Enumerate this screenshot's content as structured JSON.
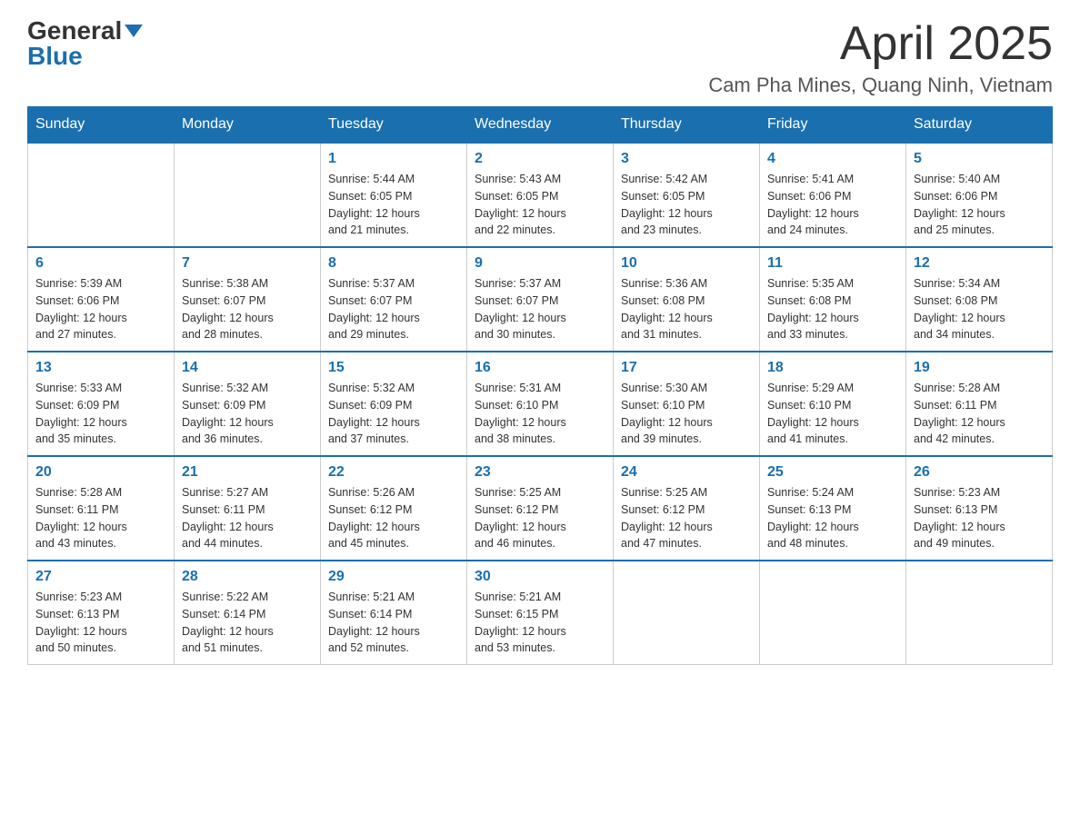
{
  "header": {
    "logo_general": "General",
    "logo_blue": "Blue",
    "month_title": "April 2025",
    "location": "Cam Pha Mines, Quang Ninh, Vietnam"
  },
  "days_of_week": [
    "Sunday",
    "Monday",
    "Tuesday",
    "Wednesday",
    "Thursday",
    "Friday",
    "Saturday"
  ],
  "weeks": [
    [
      {
        "day": "",
        "info": ""
      },
      {
        "day": "",
        "info": ""
      },
      {
        "day": "1",
        "info": "Sunrise: 5:44 AM\nSunset: 6:05 PM\nDaylight: 12 hours\nand 21 minutes."
      },
      {
        "day": "2",
        "info": "Sunrise: 5:43 AM\nSunset: 6:05 PM\nDaylight: 12 hours\nand 22 minutes."
      },
      {
        "day": "3",
        "info": "Sunrise: 5:42 AM\nSunset: 6:05 PM\nDaylight: 12 hours\nand 23 minutes."
      },
      {
        "day": "4",
        "info": "Sunrise: 5:41 AM\nSunset: 6:06 PM\nDaylight: 12 hours\nand 24 minutes."
      },
      {
        "day": "5",
        "info": "Sunrise: 5:40 AM\nSunset: 6:06 PM\nDaylight: 12 hours\nand 25 minutes."
      }
    ],
    [
      {
        "day": "6",
        "info": "Sunrise: 5:39 AM\nSunset: 6:06 PM\nDaylight: 12 hours\nand 27 minutes."
      },
      {
        "day": "7",
        "info": "Sunrise: 5:38 AM\nSunset: 6:07 PM\nDaylight: 12 hours\nand 28 minutes."
      },
      {
        "day": "8",
        "info": "Sunrise: 5:37 AM\nSunset: 6:07 PM\nDaylight: 12 hours\nand 29 minutes."
      },
      {
        "day": "9",
        "info": "Sunrise: 5:37 AM\nSunset: 6:07 PM\nDaylight: 12 hours\nand 30 minutes."
      },
      {
        "day": "10",
        "info": "Sunrise: 5:36 AM\nSunset: 6:08 PM\nDaylight: 12 hours\nand 31 minutes."
      },
      {
        "day": "11",
        "info": "Sunrise: 5:35 AM\nSunset: 6:08 PM\nDaylight: 12 hours\nand 33 minutes."
      },
      {
        "day": "12",
        "info": "Sunrise: 5:34 AM\nSunset: 6:08 PM\nDaylight: 12 hours\nand 34 minutes."
      }
    ],
    [
      {
        "day": "13",
        "info": "Sunrise: 5:33 AM\nSunset: 6:09 PM\nDaylight: 12 hours\nand 35 minutes."
      },
      {
        "day": "14",
        "info": "Sunrise: 5:32 AM\nSunset: 6:09 PM\nDaylight: 12 hours\nand 36 minutes."
      },
      {
        "day": "15",
        "info": "Sunrise: 5:32 AM\nSunset: 6:09 PM\nDaylight: 12 hours\nand 37 minutes."
      },
      {
        "day": "16",
        "info": "Sunrise: 5:31 AM\nSunset: 6:10 PM\nDaylight: 12 hours\nand 38 minutes."
      },
      {
        "day": "17",
        "info": "Sunrise: 5:30 AM\nSunset: 6:10 PM\nDaylight: 12 hours\nand 39 minutes."
      },
      {
        "day": "18",
        "info": "Sunrise: 5:29 AM\nSunset: 6:10 PM\nDaylight: 12 hours\nand 41 minutes."
      },
      {
        "day": "19",
        "info": "Sunrise: 5:28 AM\nSunset: 6:11 PM\nDaylight: 12 hours\nand 42 minutes."
      }
    ],
    [
      {
        "day": "20",
        "info": "Sunrise: 5:28 AM\nSunset: 6:11 PM\nDaylight: 12 hours\nand 43 minutes."
      },
      {
        "day": "21",
        "info": "Sunrise: 5:27 AM\nSunset: 6:11 PM\nDaylight: 12 hours\nand 44 minutes."
      },
      {
        "day": "22",
        "info": "Sunrise: 5:26 AM\nSunset: 6:12 PM\nDaylight: 12 hours\nand 45 minutes."
      },
      {
        "day": "23",
        "info": "Sunrise: 5:25 AM\nSunset: 6:12 PM\nDaylight: 12 hours\nand 46 minutes."
      },
      {
        "day": "24",
        "info": "Sunrise: 5:25 AM\nSunset: 6:12 PM\nDaylight: 12 hours\nand 47 minutes."
      },
      {
        "day": "25",
        "info": "Sunrise: 5:24 AM\nSunset: 6:13 PM\nDaylight: 12 hours\nand 48 minutes."
      },
      {
        "day": "26",
        "info": "Sunrise: 5:23 AM\nSunset: 6:13 PM\nDaylight: 12 hours\nand 49 minutes."
      }
    ],
    [
      {
        "day": "27",
        "info": "Sunrise: 5:23 AM\nSunset: 6:13 PM\nDaylight: 12 hours\nand 50 minutes."
      },
      {
        "day": "28",
        "info": "Sunrise: 5:22 AM\nSunset: 6:14 PM\nDaylight: 12 hours\nand 51 minutes."
      },
      {
        "day": "29",
        "info": "Sunrise: 5:21 AM\nSunset: 6:14 PM\nDaylight: 12 hours\nand 52 minutes."
      },
      {
        "day": "30",
        "info": "Sunrise: 5:21 AM\nSunset: 6:15 PM\nDaylight: 12 hours\nand 53 minutes."
      },
      {
        "day": "",
        "info": ""
      },
      {
        "day": "",
        "info": ""
      },
      {
        "day": "",
        "info": ""
      }
    ]
  ]
}
